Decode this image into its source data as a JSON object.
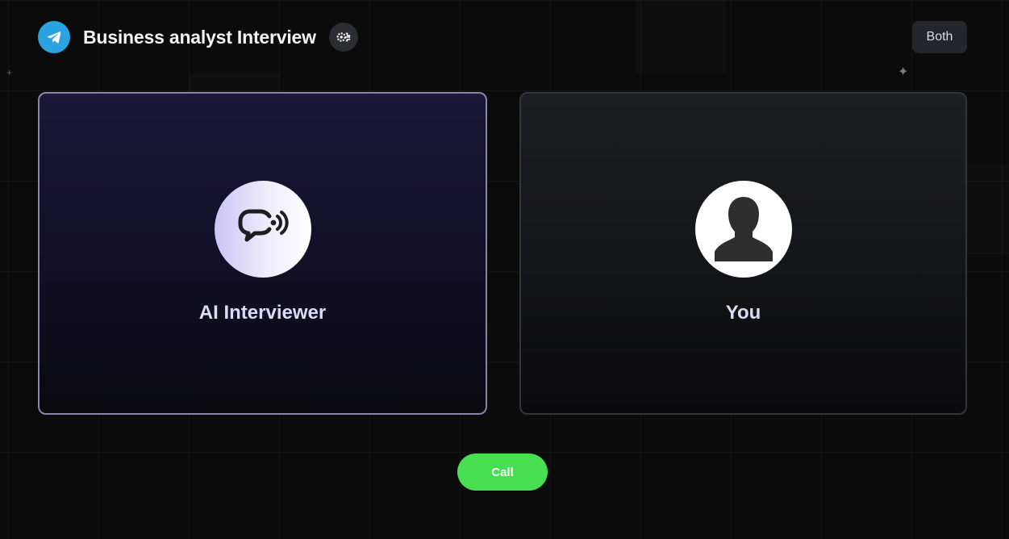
{
  "header": {
    "title": "Business analyst Interview",
    "logo_icon": "telegram-icon",
    "badge_icon": "brain-gear-icon"
  },
  "mode_button": {
    "label": "Both"
  },
  "panels": {
    "ai": {
      "label": "AI Interviewer",
      "icon": "chat-audio-icon"
    },
    "user": {
      "label": "You",
      "icon": "user-silhouette-icon"
    }
  },
  "call_button": {
    "label": "Call",
    "color": "#47de51"
  },
  "colors": {
    "background": "#0b0b0c",
    "ai_panel_border": "#8a84a8",
    "accent_telegram": "#2aa3e0"
  }
}
